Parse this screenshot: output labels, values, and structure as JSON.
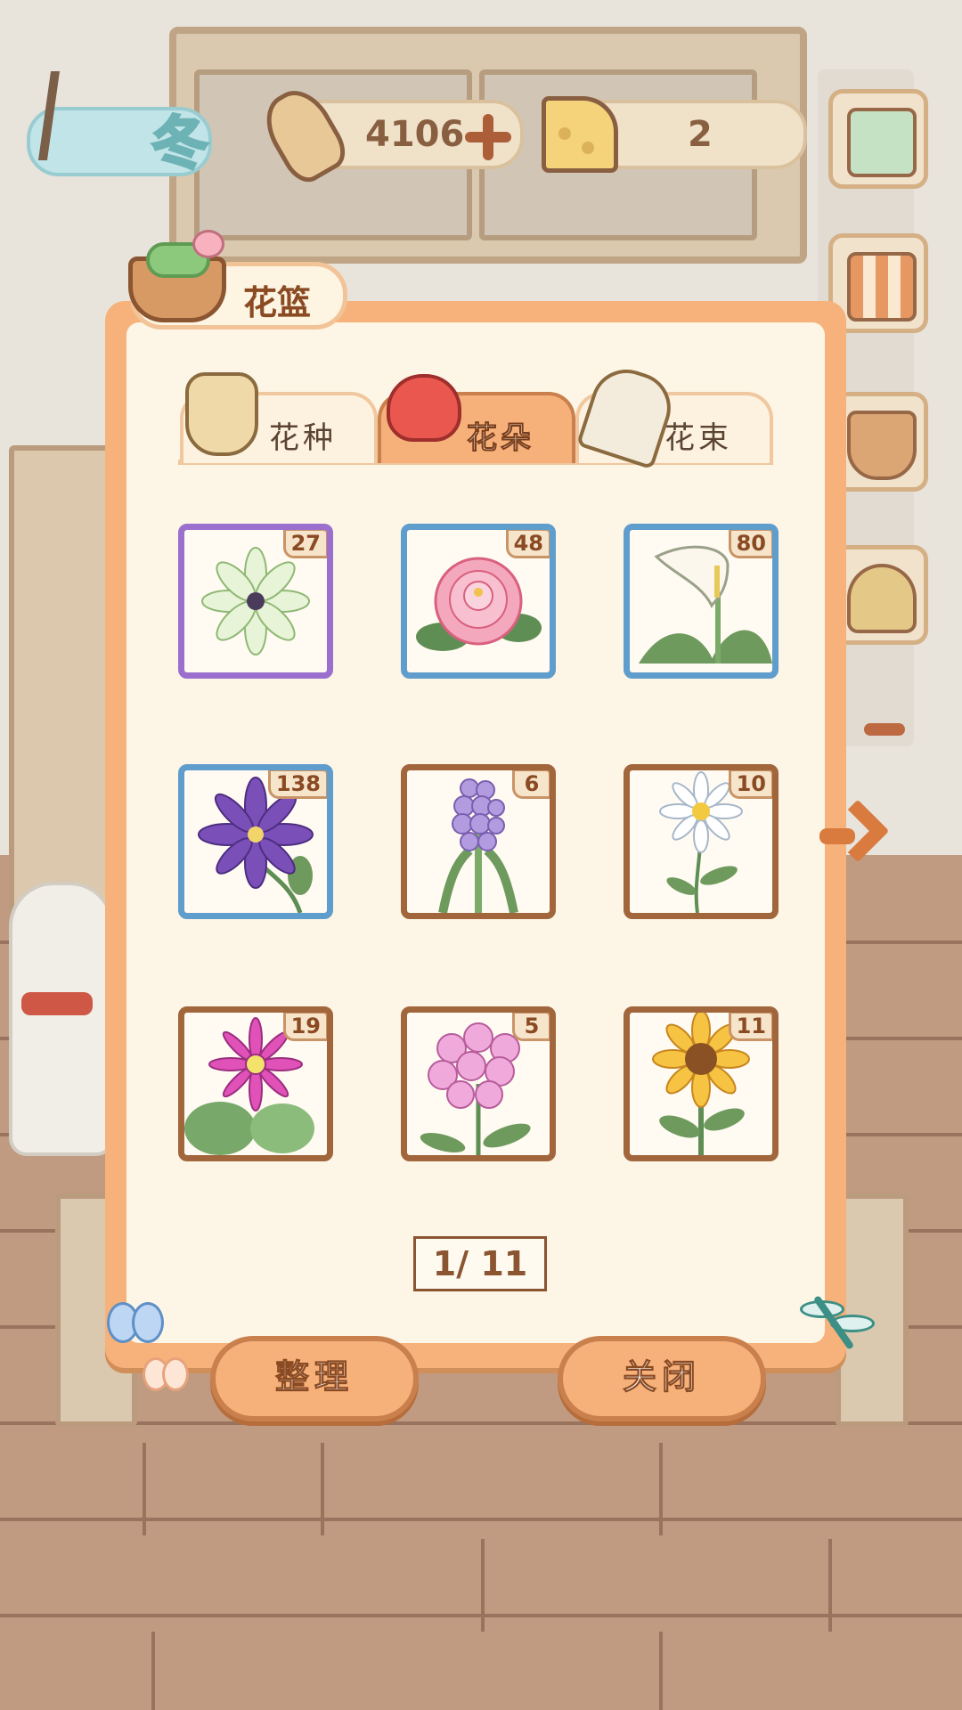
{
  "hud": {
    "season_label": "冬",
    "fish_amount": "4106",
    "cheese_amount": "2"
  },
  "panel": {
    "title": "花篮",
    "tabs": [
      {
        "label": "花种",
        "icon": "seed-bag-icon",
        "active": false
      },
      {
        "label": "花朵",
        "icon": "rose-icon",
        "active": true
      },
      {
        "label": "花束",
        "icon": "bouquet-icon",
        "active": false
      }
    ],
    "items": [
      {
        "flower": "white-chrysanthemum",
        "count": "27",
        "rarity": "purple"
      },
      {
        "flower": "pink-peony",
        "count": "48",
        "rarity": "blue"
      },
      {
        "flower": "calla-lily",
        "count": "80",
        "rarity": "blue"
      },
      {
        "flower": "purple-clematis",
        "count": "138",
        "rarity": "blue"
      },
      {
        "flower": "hyacinth",
        "count": "6",
        "rarity": "brown"
      },
      {
        "flower": "daisy",
        "count": "10",
        "rarity": "brown"
      },
      {
        "flower": "pink-gerbera",
        "count": "19",
        "rarity": "brown"
      },
      {
        "flower": "pink-phlox",
        "count": "5",
        "rarity": "brown"
      },
      {
        "flower": "sunflower",
        "count": "11",
        "rarity": "brown"
      }
    ],
    "pager": "1/ 11",
    "buttons": {
      "sort": "整理",
      "close": "关闭"
    }
  },
  "colors": {
    "panel_orange": "#f6b27a",
    "rarity_purple": "#9a6fce",
    "rarity_blue": "#5f9dcd",
    "rarity_brown": "#a2663c"
  }
}
